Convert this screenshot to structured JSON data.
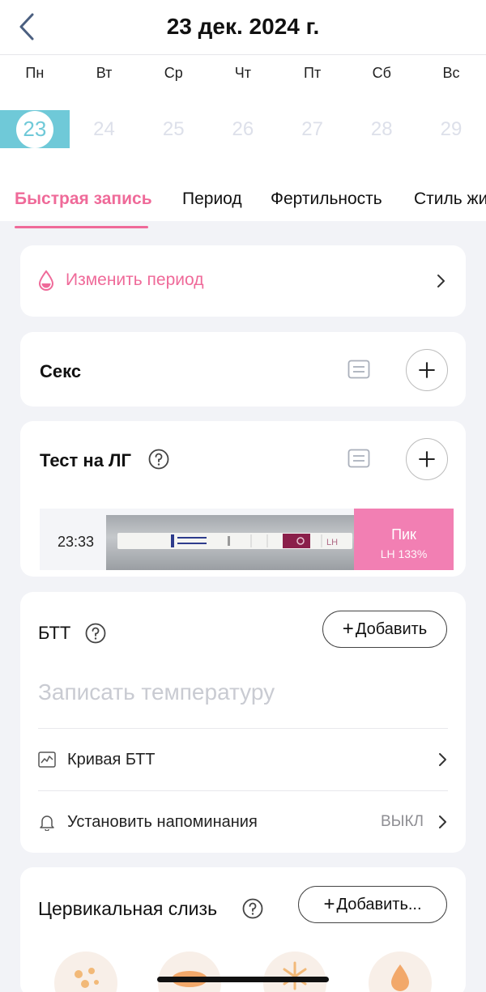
{
  "header": {
    "title": "23 дек. 2024 г."
  },
  "week": {
    "days": [
      "Пн",
      "Вт",
      "Ср",
      "Чт",
      "Пт",
      "Сб",
      "Вс"
    ],
    "dates": [
      "23",
      "24",
      "25",
      "26",
      "27",
      "28",
      "29"
    ],
    "selected_index": 0
  },
  "tabs": [
    {
      "label": "Быстрая запись",
      "active": true
    },
    {
      "label": "Период"
    },
    {
      "label": "Фертильность"
    },
    {
      "label": "Стиль жизни"
    }
  ],
  "period_card": {
    "label": "Изменить период"
  },
  "sex_card": {
    "title": "Секс"
  },
  "lh_card": {
    "title": "Тест на ЛГ",
    "entry": {
      "time": "23:33",
      "result": "Пик",
      "detail": "LH 133%"
    }
  },
  "btt_card": {
    "title": "БТТ",
    "add_label": "Добавить",
    "placeholder": "Записать температуру",
    "curve_label": "Кривая БТТ",
    "reminder_label": "Установить напоминания",
    "reminder_value": "ВЫКЛ"
  },
  "cervical_card": {
    "title": "Цервикальная слизь",
    "add_label": "Добавить..."
  },
  "icons": {
    "back": "chevron-left-icon",
    "drop": "drop-icon",
    "note": "note-icon",
    "plus": "plus-icon",
    "help": "help-circle-icon",
    "chart": "chart-icon",
    "bell": "bell-icon",
    "chevron": "chevron-right-icon"
  },
  "colors": {
    "accent": "#ef6a99",
    "selected_day": "#6fc9d8",
    "lh_peak": "#f27fb3",
    "background": "#f2f3f7"
  }
}
